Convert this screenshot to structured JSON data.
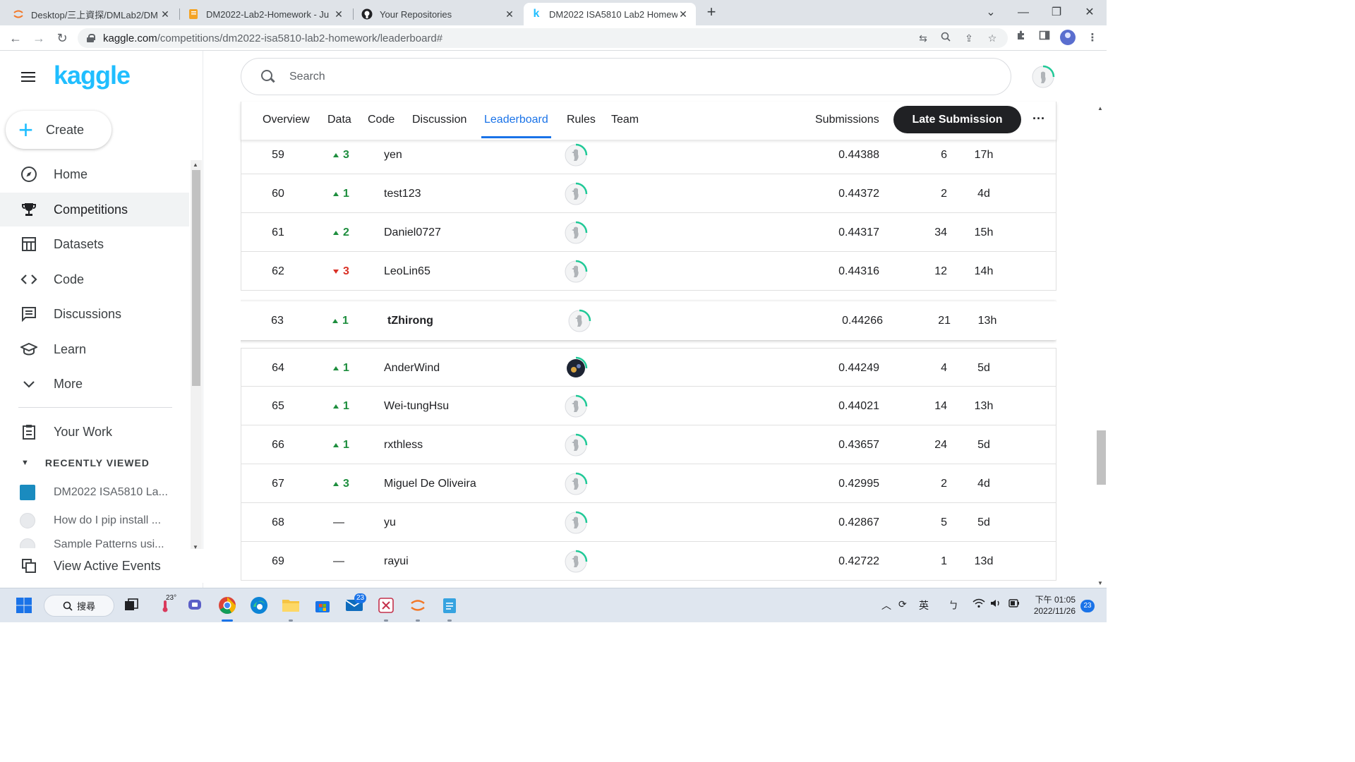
{
  "browser": {
    "tabs": [
      {
        "title": "Desktop/三上資探/DMLab2/DM",
        "icon": "jupyter-icon",
        "active": false
      },
      {
        "title": "DM2022-Lab2-Homework - Ju",
        "icon": "notebook-icon",
        "active": false
      },
      {
        "title": "Your Repositories",
        "icon": "github-icon",
        "active": false
      },
      {
        "title": "DM2022 ISA5810 Lab2 Homew",
        "icon": "kaggle-icon",
        "active": true
      }
    ],
    "url_host": "kaggle.com",
    "url_path": "/competitions/dm2022-isa5810-lab2-homework/leaderboard#"
  },
  "sidebar": {
    "logo": "kaggle",
    "create_label": "Create",
    "nav": [
      {
        "label": "Home",
        "icon": "compass-icon",
        "active": false
      },
      {
        "label": "Competitions",
        "icon": "trophy-icon",
        "active": true
      },
      {
        "label": "Datasets",
        "icon": "table-icon",
        "active": false
      },
      {
        "label": "Code",
        "icon": "code-icon",
        "active": false
      },
      {
        "label": "Discussions",
        "icon": "discussion-icon",
        "active": false
      },
      {
        "label": "Learn",
        "icon": "graduation-cap-icon",
        "active": false
      },
      {
        "label": "More",
        "icon": "chevron-down-icon",
        "active": false
      }
    ],
    "your_work": "Your Work",
    "recently_viewed_header": "RECENTLY VIEWED",
    "recent": [
      {
        "label": "DM2022 ISA5810 La...",
        "icon": "competition-thumbnail-icon"
      },
      {
        "label": "How do I pip install ...",
        "icon": "goose-avatar-icon"
      },
      {
        "label": "Sample Patterns usi...",
        "icon": "goose-avatar-icon"
      }
    ],
    "view_active_events": "View Active Events"
  },
  "search": {
    "placeholder": "Search"
  },
  "competition_nav": {
    "tabs": [
      "Overview",
      "Data",
      "Code",
      "Discussion",
      "Leaderboard",
      "Rules",
      "Team"
    ],
    "active_tab": "Leaderboard",
    "submissions_label": "Submissions",
    "late_submission_label": "Late Submission"
  },
  "leaderboard": [
    {
      "rank": "59",
      "delta": "3",
      "dir": "up",
      "team": "yen",
      "score": "0.44388",
      "entries": "6",
      "last": "17h",
      "avatar": "goose"
    },
    {
      "rank": "60",
      "delta": "1",
      "dir": "up",
      "team": "test123",
      "score": "0.44372",
      "entries": "2",
      "last": "4d",
      "avatar": "goose"
    },
    {
      "rank": "61",
      "delta": "2",
      "dir": "up",
      "team": "Daniel0727",
      "score": "0.44317",
      "entries": "34",
      "last": "15h",
      "avatar": "goose"
    },
    {
      "rank": "62",
      "delta": "3",
      "dir": "down",
      "team": "LeoLin65",
      "score": "0.44316",
      "entries": "12",
      "last": "14h",
      "avatar": "goose"
    },
    {
      "rank": "63",
      "delta": "1",
      "dir": "up",
      "team": "tZhirong",
      "score": "0.44266",
      "entries": "21",
      "last": "13h",
      "avatar": "goose",
      "me": true
    },
    {
      "rank": "64",
      "delta": "1",
      "dir": "up",
      "team": "AnderWind",
      "score": "0.44249",
      "entries": "4",
      "last": "5d",
      "avatar": "photo"
    },
    {
      "rank": "65",
      "delta": "1",
      "dir": "up",
      "team": "Wei-tungHsu",
      "score": "0.44021",
      "entries": "14",
      "last": "13h",
      "avatar": "goose"
    },
    {
      "rank": "66",
      "delta": "1",
      "dir": "up",
      "team": "rxthless",
      "score": "0.43657",
      "entries": "24",
      "last": "5d",
      "avatar": "goose"
    },
    {
      "rank": "67",
      "delta": "3",
      "dir": "up",
      "team": "Miguel De Oliveira",
      "score": "0.42995",
      "entries": "2",
      "last": "4d",
      "avatar": "goose"
    },
    {
      "rank": "68",
      "delta": "—",
      "dir": "none",
      "team": "yu",
      "score": "0.42867",
      "entries": "5",
      "last": "5d",
      "avatar": "goose"
    },
    {
      "rank": "69",
      "delta": "—",
      "dir": "none",
      "team": "rayui",
      "score": "0.42722",
      "entries": "1",
      "last": "13d",
      "avatar": "goose"
    }
  ],
  "taskbar": {
    "search_label": "搜尋",
    "weather_temp": "23°",
    "mail_badge": "23",
    "ime_label": "英",
    "ime_mode": "ㄅ",
    "time": "下午 01:05",
    "date": "2022/11/26",
    "notification_count": "23"
  },
  "colors": {
    "kaggle_blue": "#20beff",
    "active_tab_blue": "#1a73e8",
    "rank_up_green": "#1e8e3e",
    "rank_down_red": "#d93025"
  }
}
